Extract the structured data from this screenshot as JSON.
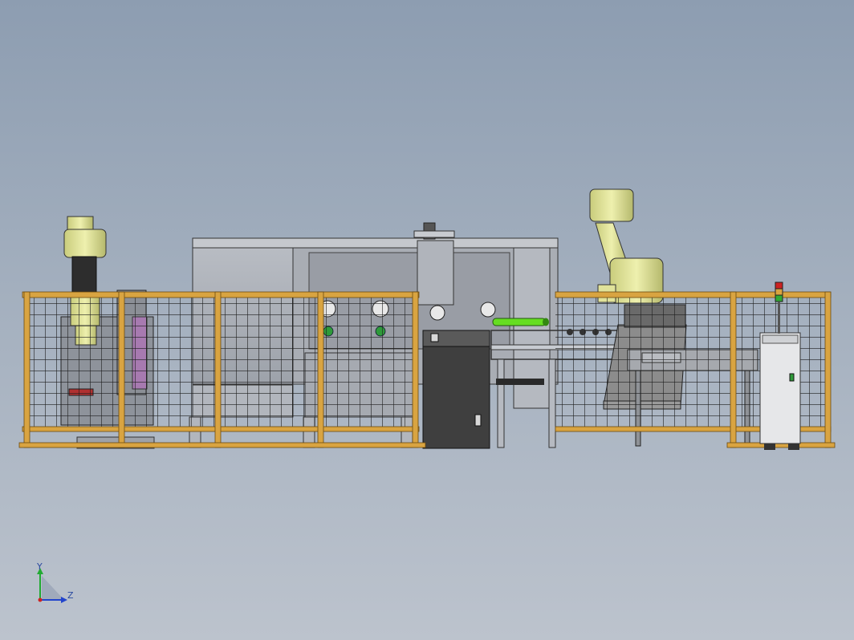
{
  "viewport": {
    "colors": {
      "background_top": "#8d9db1",
      "background_bottom": "#bcc3cd",
      "fence_frame": "#d9a441",
      "robot": "#e0e29a",
      "highlight_tube": "#66dd22",
      "cabinet": "#3f3f3f"
    }
  },
  "triad": {
    "y_label": "Y",
    "z_label": "Z",
    "y_color": "#22aa33",
    "z_color": "#2244cc",
    "x_color": "#cc2222"
  },
  "model": {
    "components": [
      {
        "name": "left-robot-cell",
        "icon": "robot-arm-icon"
      },
      {
        "name": "processing-machine",
        "icon": "machine-icon"
      },
      {
        "name": "control-cabinet",
        "icon": "cabinet-icon"
      },
      {
        "name": "conveyor",
        "icon": "conveyor-icon"
      },
      {
        "name": "right-robot",
        "icon": "robot-arm-icon"
      },
      {
        "name": "work-table",
        "icon": "table-icon"
      },
      {
        "name": "electrical-cabinet",
        "icon": "cabinet-icon"
      },
      {
        "name": "signal-tower",
        "icon": "signal-tower-icon"
      }
    ]
  }
}
